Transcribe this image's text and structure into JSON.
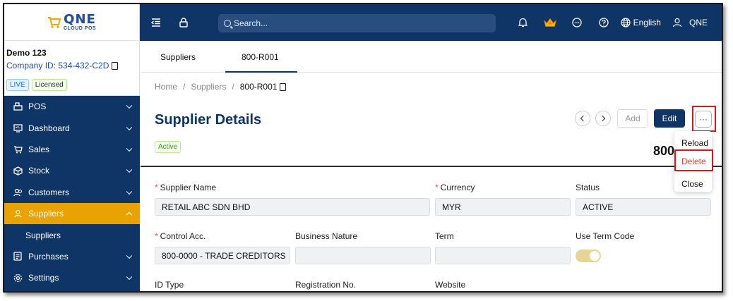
{
  "logo": {
    "main": "QNE",
    "sub": "CLOUD POS"
  },
  "company": {
    "name": "Demo 123",
    "id": "Company ID: 534-432-C2D",
    "badges": [
      "LIVE",
      "Licensed"
    ]
  },
  "nav": {
    "items": [
      {
        "label": "POS",
        "icon": "pos-icon"
      },
      {
        "label": "Dashboard",
        "icon": "dashboard-icon"
      },
      {
        "label": "Sales",
        "icon": "sales-icon"
      },
      {
        "label": "Stock",
        "icon": "stock-icon"
      },
      {
        "label": "Customers",
        "icon": "customers-icon"
      },
      {
        "label": "Suppliers",
        "icon": "suppliers-icon",
        "active": true
      },
      {
        "label": "Purchases",
        "icon": "purchases-icon"
      },
      {
        "label": "Settings",
        "icon": "settings-icon"
      }
    ],
    "sub_items": [
      "Suppliers"
    ]
  },
  "topbar": {
    "search_placeholder": "Search...",
    "language": "English",
    "user": "QNE"
  },
  "tabs": [
    "Suppliers",
    "800-R001"
  ],
  "breadcrumb": {
    "home": "Home",
    "section": "Suppliers",
    "current": "800-R001",
    "sep": "/"
  },
  "page": {
    "title": "Supplier Details",
    "status": "Active",
    "code_peek": "800"
  },
  "actions": {
    "add": "Add",
    "edit": "Edit",
    "more": "···"
  },
  "menu": {
    "reload": "Reload",
    "delete": "Delete",
    "close": "Close"
  },
  "form": {
    "supplier_name_label": "Supplier Name",
    "supplier_name": "RETAIL ABC SDN BHD",
    "currency_label": "Currency",
    "currency": "MYR",
    "status_label": "Status",
    "status": "ACTIVE",
    "control_acc_label": "Control Acc.",
    "control_acc": "800-0000 - TRADE CREDITORS",
    "business_nature_label": "Business Nature",
    "business_nature": "",
    "term_label": "Term",
    "term": "",
    "use_term_code_label": "Use Term Code",
    "use_term_code": true,
    "id_type_label": "ID Type",
    "registration_label": "Registration No.",
    "website_label": "Website",
    "required_mark": "*"
  },
  "colors": {
    "primary": "#0f3466",
    "accent": "#e8a300",
    "highlight": "#e01414",
    "danger": "#e0463d"
  }
}
